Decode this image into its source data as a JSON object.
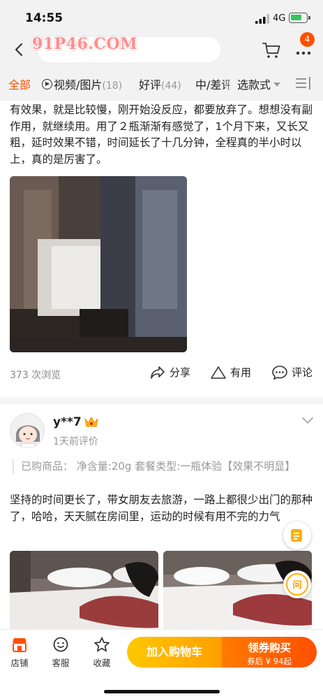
{
  "status_bar": {
    "time": "14:55",
    "network": "4G"
  },
  "header": {
    "watermark": "91P46.COM",
    "notification_count": "4"
  },
  "tabs": [
    {
      "label": "全部"
    },
    {
      "label": "视频/图片",
      "count": "(18)"
    },
    {
      "label": "好评",
      "count": "(44)"
    },
    {
      "label": "中/差评"
    },
    {
      "label": "选款式"
    }
  ],
  "review1": {
    "text": "有效果，就是比较慢，刚开始没反应，都要放弃了。想想没有副作用，就继续用。用了２瓶渐渐有感觉了，1个月下来，又长又粗，延时效果不错，时间延长了十几分钟，全程真的半小时以上，真的是厉害了。",
    "views": "373 次浏览",
    "share": "分享",
    "useful": "有用",
    "comment": "评论"
  },
  "review2": {
    "username": "y**7",
    "date": "1天前评价",
    "purchased": "已购商品：  净含量:20g    套餐类型:一瓶体验【效果不明显】",
    "text": "坚持的时间更长了，带女朋友去旅游，一路上都很少出门的那种了，哈哈，天天腻在房间里，运动的时候有用不完的力气"
  },
  "float_buttons": {
    "ask": "问"
  },
  "bottom_bar": {
    "shop": "店铺",
    "service": "客服",
    "favorite": "收藏",
    "add_to_cart": "加入购物车",
    "buy_label": "领券购买",
    "buy_price": "券后 ¥ 94起"
  },
  "colors": {
    "accent": "#ff5000",
    "cart_button": "#ffb000",
    "buy_button": "#ff5000"
  }
}
